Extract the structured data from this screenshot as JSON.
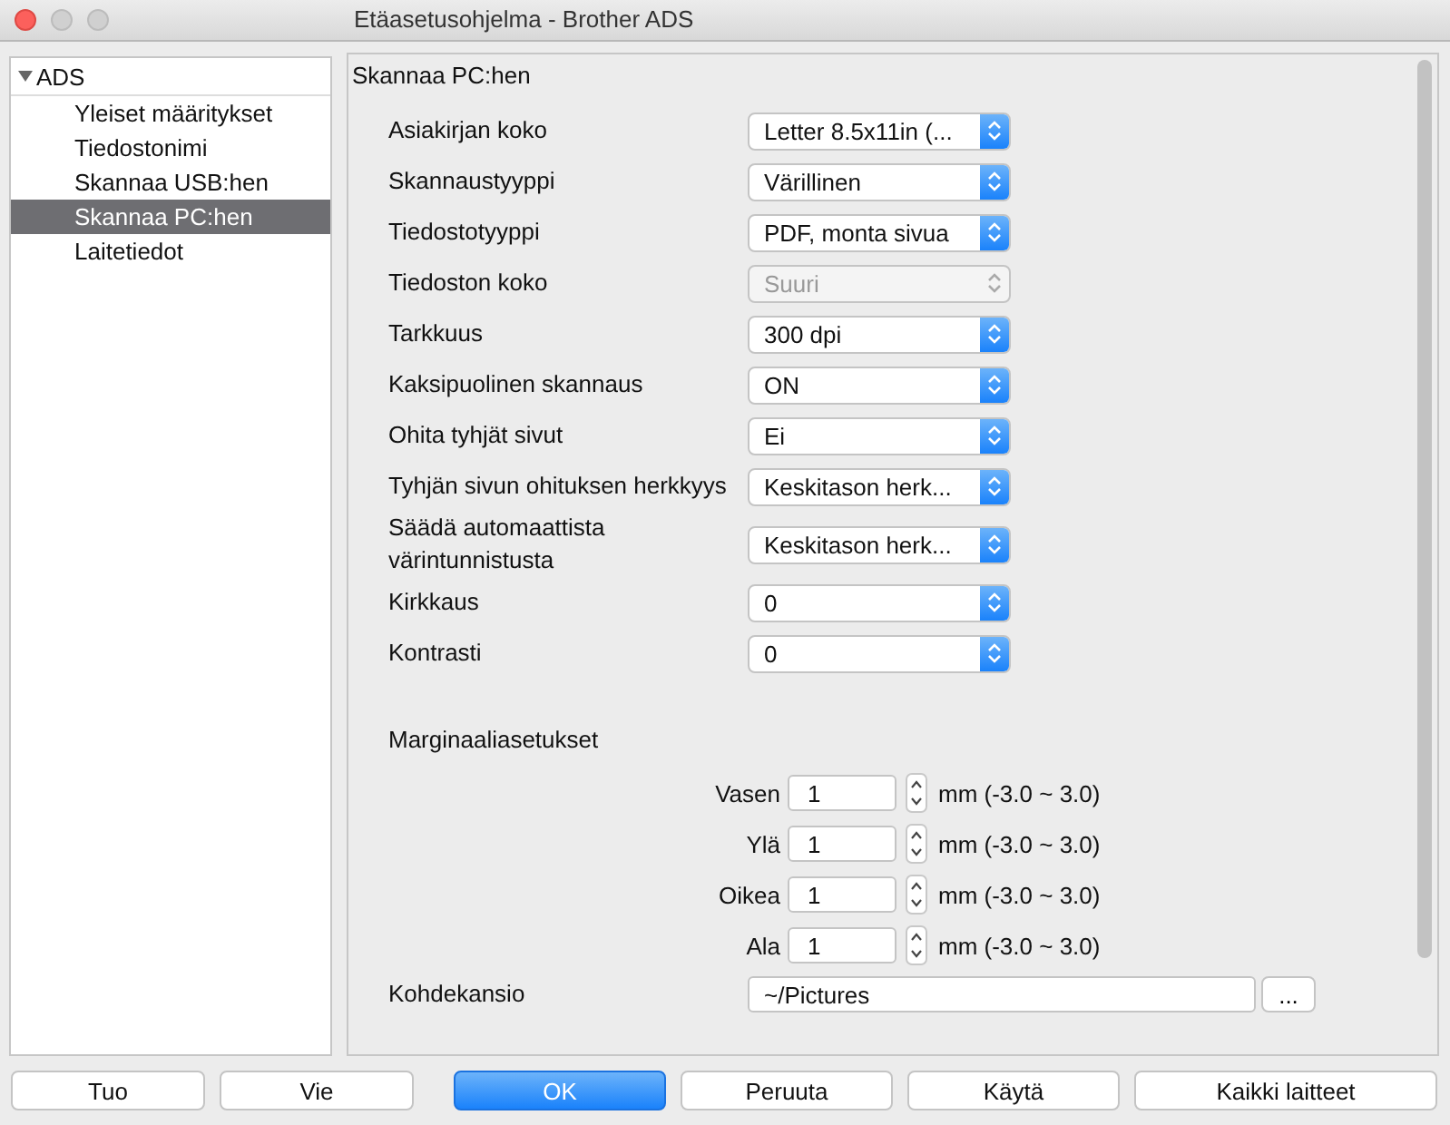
{
  "window": {
    "title": "Etäasetusohjelma - Brother ADS"
  },
  "sidebar": {
    "root": {
      "label": "ADS",
      "expanded": true,
      "children": [
        {
          "label": "Yleiset määritykset",
          "selected": false
        },
        {
          "label": "Tiedostonimi",
          "selected": false
        },
        {
          "label": "Skannaa USB:hen",
          "selected": false
        },
        {
          "label": "Skannaa PC:hen",
          "selected": true
        },
        {
          "label": "Laitetiedot",
          "selected": false
        }
      ]
    }
  },
  "panel": {
    "title": "Skannaa PC:hen",
    "settings": [
      {
        "label": "Asiakirjan koko",
        "value": "Letter 8.5x11in (...",
        "disabled": false
      },
      {
        "label": "Skannaustyyppi",
        "value": "Värillinen",
        "disabled": false
      },
      {
        "label": "Tiedostotyyppi",
        "value": "PDF, monta sivua",
        "disabled": false
      },
      {
        "label": "Tiedoston koko",
        "value": "Suuri",
        "disabled": true
      },
      {
        "label": "Tarkkuus",
        "value": "300 dpi",
        "disabled": false
      },
      {
        "label": "Kaksipuolinen skannaus",
        "value": "ON",
        "disabled": false
      },
      {
        "label": "Ohita tyhjät sivut",
        "value": "Ei",
        "disabled": false
      },
      {
        "label": "Tyhjän sivun ohituksen herkkyys",
        "value": "Keskitason herk...",
        "disabled": false
      },
      {
        "label": "Säädä automaattista värintunnistusta",
        "value": "Keskitason herk...",
        "disabled": false
      },
      {
        "label": "Kirkkaus",
        "value": "0",
        "disabled": false
      },
      {
        "label": "Kontrasti",
        "value": "0",
        "disabled": false
      }
    ],
    "margins": {
      "title": "Marginaaliasetukset",
      "rows": [
        {
          "label": "Vasen",
          "value": "1",
          "range": "mm (-3.0 ~ 3.0)"
        },
        {
          "label": "Ylä",
          "value": "1",
          "range": "mm (-3.0 ~ 3.0)"
        },
        {
          "label": "Oikea",
          "value": "1",
          "range": "mm (-3.0 ~ 3.0)"
        },
        {
          "label": "Ala",
          "value": "1",
          "range": "mm (-3.0 ~ 3.0)"
        }
      ]
    },
    "destination": {
      "label": "Kohdekansio",
      "value": "~/Pictures",
      "browse": "..."
    }
  },
  "buttons_left": [
    {
      "label": "Tuo",
      "primary": false
    },
    {
      "label": "Vie",
      "primary": false
    }
  ],
  "buttons_right": [
    {
      "label": "OK",
      "primary": true
    },
    {
      "label": "Peruuta",
      "primary": false
    },
    {
      "label": "Käytä",
      "primary": false
    },
    {
      "label": "Kaikki laitteet",
      "primary": false
    }
  ]
}
